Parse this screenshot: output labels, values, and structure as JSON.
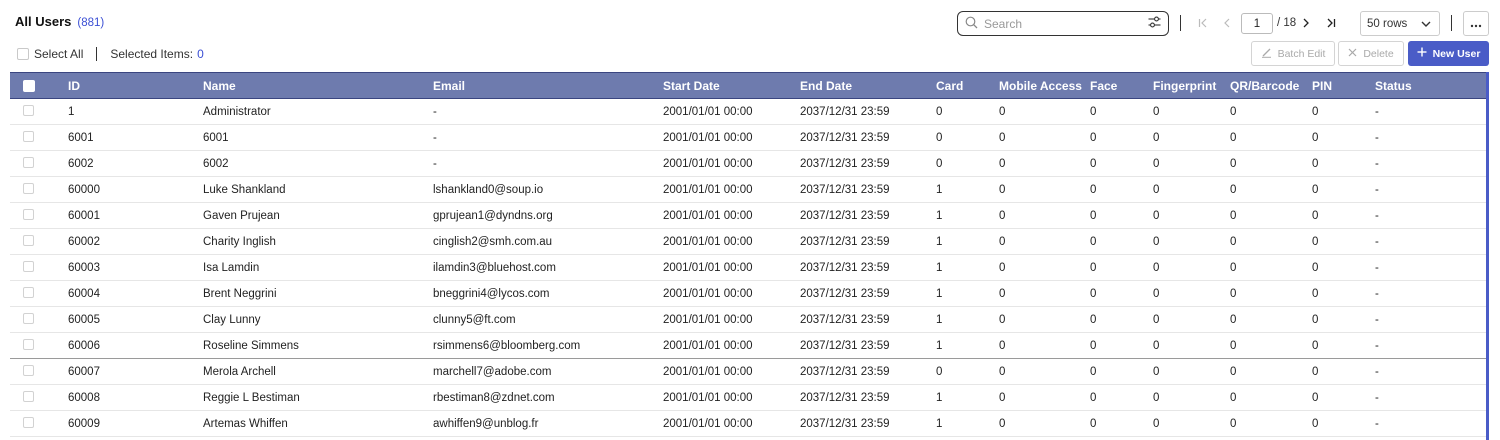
{
  "header": {
    "title": "All Users",
    "count": "(881)",
    "select_all_label": "Select All",
    "selected_items_label": "Selected Items:",
    "selected_items_count": "0"
  },
  "search": {
    "placeholder": "Search",
    "value": ""
  },
  "pagination": {
    "current_page": "1",
    "total_label": "/ 18",
    "rows_per_page": "50 rows"
  },
  "actions": {
    "batch_edit": "Batch Edit",
    "delete": "Delete",
    "new_user": "New User"
  },
  "table": {
    "columns": [
      "ID",
      "Name",
      "Email",
      "Start Date",
      "End Date",
      "Card",
      "Mobile Access",
      "Face",
      "Fingerprint",
      "QR/Barcode",
      "PIN",
      "Status"
    ],
    "rows": [
      [
        "1",
        "Administrator",
        "-",
        "2001/01/01 00:00",
        "2037/12/31 23:59",
        "0",
        "0",
        "0",
        "0",
        "0",
        "0",
        "-"
      ],
      [
        "6001",
        "6001",
        "-",
        "2001/01/01 00:00",
        "2037/12/31 23:59",
        "0",
        "0",
        "0",
        "0",
        "0",
        "0",
        "-"
      ],
      [
        "6002",
        "6002",
        "-",
        "2001/01/01 00:00",
        "2037/12/31 23:59",
        "0",
        "0",
        "0",
        "0",
        "0",
        "0",
        "-"
      ],
      [
        "60000",
        "Luke Shankland",
        "lshankland0@soup.io",
        "2001/01/01 00:00",
        "2037/12/31 23:59",
        "1",
        "0",
        "0",
        "0",
        "0",
        "0",
        "-"
      ],
      [
        "60001",
        "Gaven Prujean",
        "gprujean1@dyndns.org",
        "2001/01/01 00:00",
        "2037/12/31 23:59",
        "1",
        "0",
        "0",
        "0",
        "0",
        "0",
        "-"
      ],
      [
        "60002",
        "Charity Inglish",
        "cinglish2@smh.com.au",
        "2001/01/01 00:00",
        "2037/12/31 23:59",
        "1",
        "0",
        "0",
        "0",
        "0",
        "0",
        "-"
      ],
      [
        "60003",
        "Isa Lamdin",
        "ilamdin3@bluehost.com",
        "2001/01/01 00:00",
        "2037/12/31 23:59",
        "1",
        "0",
        "0",
        "0",
        "0",
        "0",
        "-"
      ],
      [
        "60004",
        "Brent Neggrini",
        "bneggrini4@lycos.com",
        "2001/01/01 00:00",
        "2037/12/31 23:59",
        "1",
        "0",
        "0",
        "0",
        "0",
        "0",
        "-"
      ],
      [
        "60005",
        "Clay Lunny",
        "clunny5@ft.com",
        "2001/01/01 00:00",
        "2037/12/31 23:59",
        "1",
        "0",
        "0",
        "0",
        "0",
        "0",
        "-"
      ],
      [
        "60006",
        "Roseline Simmens",
        "rsimmens6@bloomberg.com",
        "2001/01/01 00:00",
        "2037/12/31 23:59",
        "1",
        "0",
        "0",
        "0",
        "0",
        "0",
        "-"
      ],
      [
        "60007",
        "Merola Archell",
        "marchell7@adobe.com",
        "2001/01/01 00:00",
        "2037/12/31 23:59",
        "0",
        "0",
        "0",
        "0",
        "0",
        "0",
        "-"
      ],
      [
        "60008",
        "Reggie L Bestiman",
        "rbestiman8@zdnet.com",
        "2001/01/01 00:00",
        "2037/12/31 23:59",
        "1",
        "0",
        "0",
        "0",
        "0",
        "0",
        "-"
      ],
      [
        "60009",
        "Artemas Whiffen",
        "awhiffen9@unblog.fr",
        "2001/01/01 00:00",
        "2037/12/31 23:59",
        "1",
        "0",
        "0",
        "0",
        "0",
        "0",
        "-"
      ]
    ]
  },
  "colors": {
    "accent": "#4a5cc7",
    "header_bg": "#6e7bae",
    "link_count": "#3b4fd4"
  },
  "icons": [
    "search-icon",
    "filter-settings-icon",
    "first-page-icon",
    "prev-page-icon",
    "next-page-icon",
    "last-page-icon",
    "chevron-down-icon",
    "more-icon",
    "edit-icon",
    "close-icon",
    "plus-icon"
  ]
}
